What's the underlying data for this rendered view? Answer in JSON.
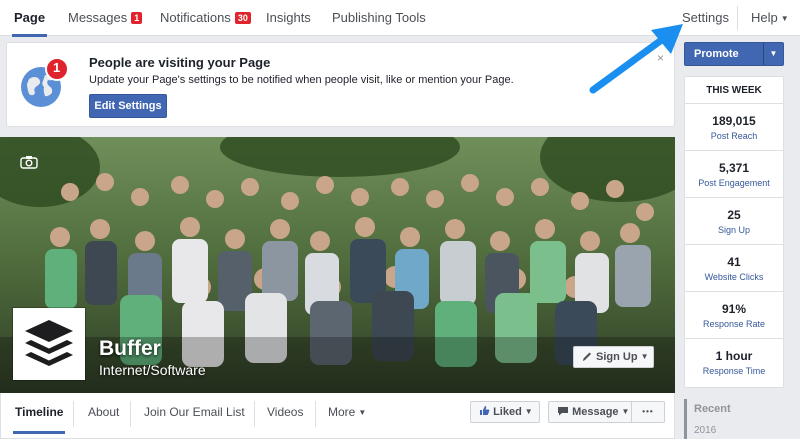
{
  "tabs": [
    {
      "label": "Page"
    },
    {
      "label": "Messages",
      "badge": "1"
    },
    {
      "label": "Notifications",
      "badge": "30"
    },
    {
      "label": "Insights"
    },
    {
      "label": "Publishing Tools"
    }
  ],
  "top_right": {
    "settings": "Settings",
    "help": "Help"
  },
  "notification": {
    "title": "People are visiting your Page",
    "text": "Update your Page's settings to be notified when people visit, like or mention your Page.",
    "button": "Edit Settings",
    "count": "1",
    "close": "×"
  },
  "page": {
    "name": "Buffer",
    "category": "Internet/Software",
    "signup_button": "Sign Up"
  },
  "page_nav": {
    "items": [
      "Timeline",
      "About",
      "Join Our Email List",
      "Videos",
      "More"
    ],
    "liked": "Liked",
    "message": "Message",
    "dots": "•••"
  },
  "sidebar": {
    "promote": "Promote",
    "week_title": "THIS WEEK",
    "stats": [
      {
        "value": "189,015",
        "label": "Post Reach"
      },
      {
        "value": "5,371",
        "label": "Post Engagement"
      },
      {
        "value": "25",
        "label": "Sign Up"
      },
      {
        "value": "41",
        "label": "Website Clicks"
      },
      {
        "value": "91%",
        "label": "Response Rate"
      },
      {
        "value": "1 hour",
        "label": "Response Time"
      }
    ],
    "recent_title": "Recent",
    "recent_year": "2016"
  },
  "colors": {
    "brand": "#4267b2",
    "badge": "#e0242d",
    "arrow": "#1b8ff0"
  }
}
